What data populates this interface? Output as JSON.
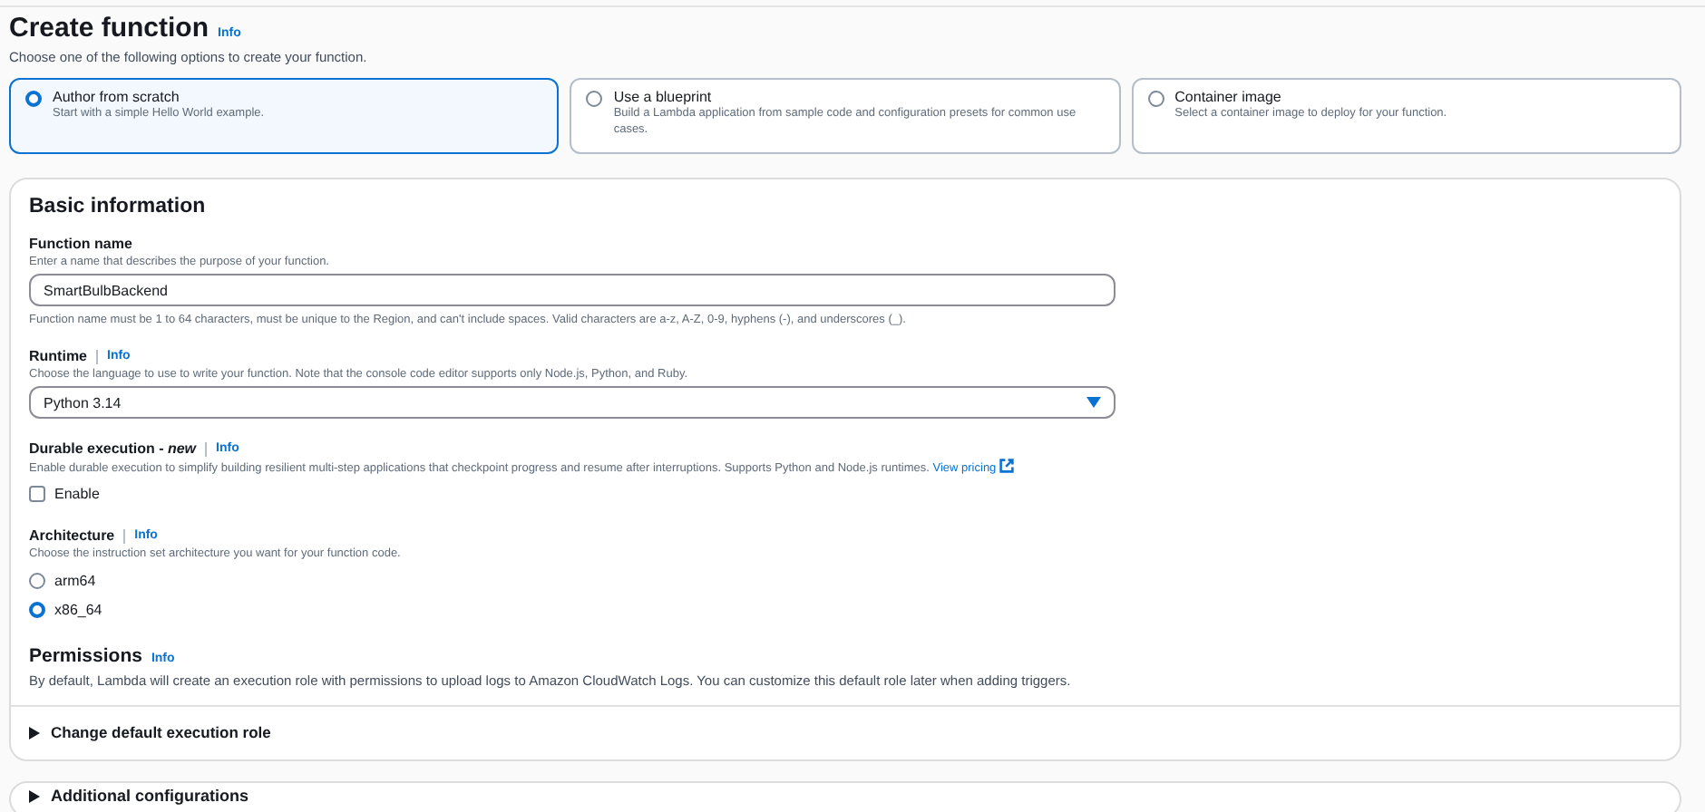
{
  "header": {
    "title": "Create function",
    "info": "Info",
    "description": "Choose one of the following options to create your function."
  },
  "options": [
    {
      "title": "Author from scratch",
      "description": "Start with a simple Hello World example.",
      "selected": true
    },
    {
      "title": "Use a blueprint",
      "description": "Build a Lambda application from sample code and configuration presets for common use cases.",
      "selected": false
    },
    {
      "title": "Container image",
      "description": "Select a container image to deploy for your function.",
      "selected": false
    }
  ],
  "basic_information": {
    "title": "Basic information",
    "fields": [
      {
        "kind": "text",
        "label": "Function name",
        "hint": "Enter a name that describes the purpose of your function.",
        "value": "SmartBulbBackend",
        "constraint": "Function name must be 1 to 64 characters, must be unique to the Region, and can't include spaces. Valid characters are a-z, A-Z, 0-9, hyphens (-), and underscores (_)."
      },
      {
        "kind": "select",
        "label": "Runtime",
        "info": "Info",
        "hint": "Choose the language to use to write your function. Note that the console code editor supports only Node.js, Python, and Ruby.",
        "value": "Python 3.14"
      },
      {
        "kind": "checkbox",
        "label": "Durable execution - *new*",
        "info": "Info",
        "hint": "Enable durable execution to simplify building resilient multi-step applications that checkpoint progress and resume after interruptions. Supports Python and Node.js runtimes.",
        "link": "View pricing",
        "option": "Enable",
        "checked": false
      },
      {
        "kind": "radio",
        "label": "Architecture",
        "info": "Info",
        "hint": "Choose the instruction set architecture you want for your function code.",
        "choices": [
          {
            "label": "arm64",
            "selected": false
          },
          {
            "label": "x86_64",
            "selected": true
          }
        ]
      }
    ],
    "permissions": {
      "title": "Permissions",
      "info": "Info",
      "description": "By default, Lambda will create an execution role with permissions to upload logs to Amazon CloudWatch Logs. You can customize this default role later when adding triggers.",
      "expander": {
        "label": "Change default execution role",
        "expanded": false
      }
    }
  },
  "additional_configurations": {
    "label": "Additional configurations",
    "expanded": false
  }
}
